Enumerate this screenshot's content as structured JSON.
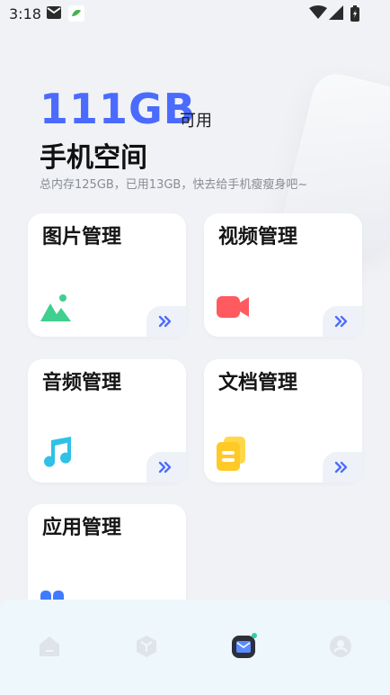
{
  "status_bar": {
    "time": "3:18"
  },
  "storage": {
    "value": "111GB",
    "unit": "可用"
  },
  "page": {
    "title": "手机空间",
    "subtitle": "总内存125GB，已用13GB，快去给手机瘦瘦身吧~"
  },
  "cards": [
    {
      "title": "图片管理",
      "icon": "image-icon"
    },
    {
      "title": "视频管理",
      "icon": "video-icon"
    },
    {
      "title": "音频管理",
      "icon": "music-icon"
    },
    {
      "title": "文档管理",
      "icon": "document-icon"
    },
    {
      "title": "应用管理",
      "icon": "apps-icon"
    }
  ],
  "bottom_nav": [
    {
      "icon": "home-icon",
      "active": false
    },
    {
      "icon": "cube-icon",
      "active": false
    },
    {
      "icon": "cleaner-icon",
      "active": true
    },
    {
      "icon": "profile-icon",
      "active": false
    }
  ],
  "colors": {
    "accent": "#4b6bff",
    "image_icon": "#3fcf8e",
    "video_icon": "#ff5a5f",
    "music_icon": "#2fc1e6",
    "doc_icon": "#ffc928",
    "apps_icon": "#3f7bff"
  }
}
